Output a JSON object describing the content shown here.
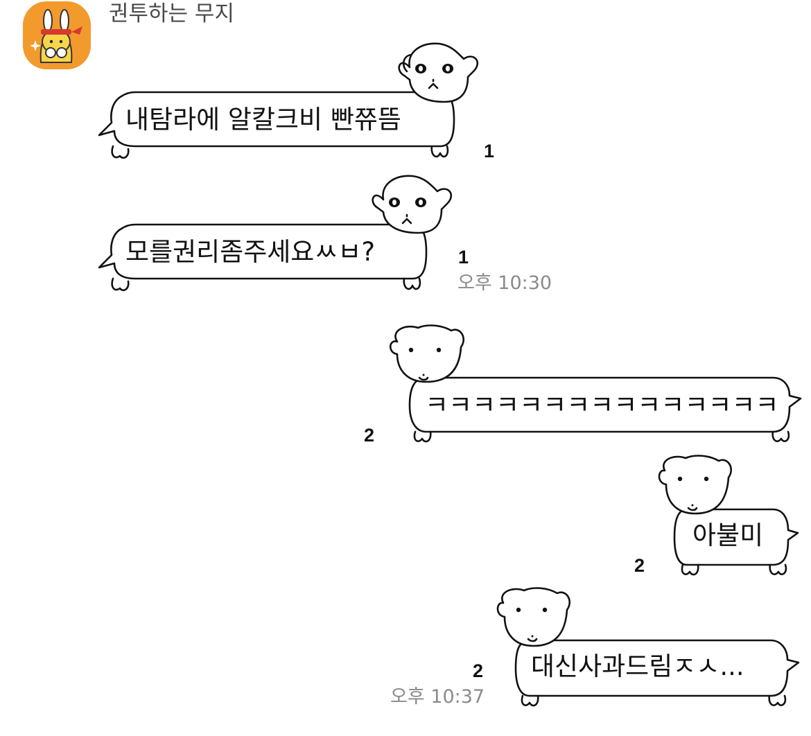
{
  "chat": {
    "sender_name": "권투하는 무지",
    "messages": [
      {
        "text": "내탐라에 알칼크비 빤쮸뜸",
        "unread": "1",
        "time": ""
      },
      {
        "text": "모를권리좀주세요ㅆㅂ?",
        "unread": "1",
        "time": "오후 10:30"
      },
      {
        "text": "ㅋㅋㅋㅋㅋㅋㅋㅋㅋㅋㅋㅋㅋㅋㅋ",
        "unread": "2",
        "time": ""
      },
      {
        "text": "아불미",
        "unread": "2",
        "time": ""
      },
      {
        "text": "대신사과드림ㅈㅅ...",
        "unread": "2",
        "time": "오후 10:37"
      }
    ]
  },
  "colors": {
    "avatar_bg": "#f39a2d",
    "time_text": "#8a8a8a",
    "bubble_outline": "#111111"
  },
  "icons": {
    "avatar": "muzi-boxer-avatar-icon",
    "bubble_dog": "long-dog-bubble-icon"
  }
}
